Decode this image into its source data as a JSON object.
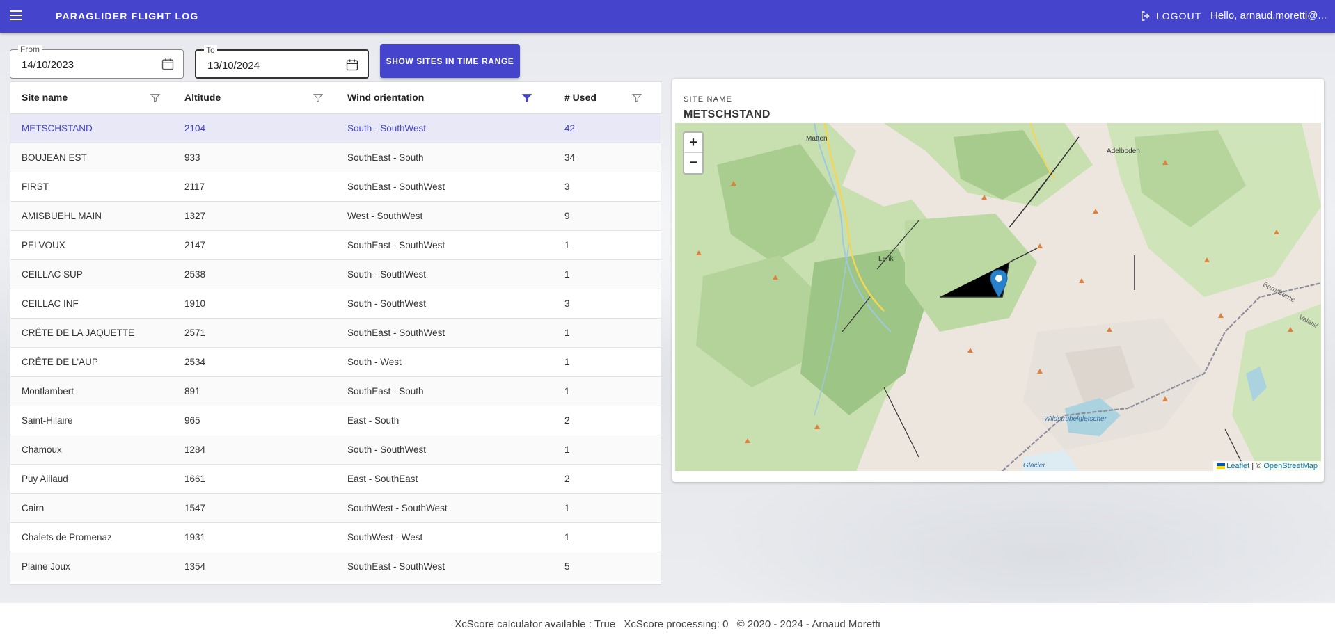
{
  "appbar": {
    "title": "PARAGLIDER FLIGHT LOG",
    "logout_label": "LOGOUT",
    "greeting": "Hello, arnaud.moretti@...",
    "color": "#4444cc"
  },
  "filters": {
    "from_label": "From",
    "from_value": "14/10/2023",
    "to_label": "To",
    "to_value": "13/10/2024",
    "show_button": "SHOW SITES IN TIME RANGE"
  },
  "table": {
    "columns": [
      "Site name",
      "Altitude",
      "Wind orientation",
      "# Used"
    ],
    "active_filter_column": "Wind orientation",
    "rows": [
      [
        "METSCHSTAND",
        "2104",
        "South - SouthWest",
        "42"
      ],
      [
        "BOUJEAN EST",
        "933",
        "SouthEast - South",
        "34"
      ],
      [
        "FIRST",
        "2117",
        "SouthEast - SouthWest",
        "3"
      ],
      [
        "AMISBUEHL MAIN",
        "1327",
        "West - SouthWest",
        "9"
      ],
      [
        "PELVOUX",
        "2147",
        "SouthEast - SouthWest",
        "1"
      ],
      [
        "CEILLAC SUP",
        "2538",
        "South - SouthWest",
        "1"
      ],
      [
        "CEILLAC INF",
        "1910",
        "South - SouthWest",
        "3"
      ],
      [
        "CRÊTE DE LA JAQUETTE",
        "2571",
        "SouthEast - SouthWest",
        "1"
      ],
      [
        "CRÊTE DE L'AUP",
        "2534",
        "South - West",
        "1"
      ],
      [
        "Montlambert",
        "891",
        "SouthEast - South",
        "1"
      ],
      [
        "Saint-Hilaire",
        "965",
        "East - South",
        "2"
      ],
      [
        "Chamoux",
        "1284",
        "South - SouthWest",
        "1"
      ],
      [
        "Puy Aillaud",
        "1661",
        "East - SouthEast",
        "2"
      ],
      [
        "Cairn",
        "1547",
        "SouthWest - SouthWest",
        "1"
      ],
      [
        "Chalets de Promenaz",
        "1931",
        "SouthWest - West",
        "1"
      ],
      [
        "Plaine Joux",
        "1354",
        "SouthEast - SouthWest",
        "5"
      ]
    ],
    "selected_index": 0
  },
  "site_card": {
    "caption": "SITE NAME",
    "name": "METSCHSTAND",
    "map": {
      "zoom_in": "+",
      "zoom_out": "−",
      "attribution_leaflet": "Leaflet",
      "attribution_sep": " | © ",
      "attribution_osm": "OpenStreetMap",
      "labels": [
        "Matten",
        "Adelboden",
        "Lenk",
        "Wildstrubelgletscher",
        "Glacier",
        "Bern/Berne",
        "Valais/"
      ]
    }
  },
  "footer": {
    "calc": "XcScore calculator available : True",
    "processing": "XcScore processing: 0",
    "copyright": "© 2020 - 2024 - Arnaud Moretti"
  }
}
